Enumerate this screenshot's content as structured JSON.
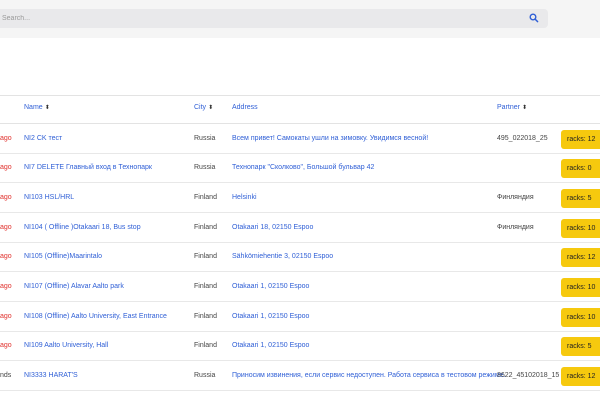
{
  "search": {
    "placeholder": "Search..."
  },
  "table": {
    "headers": {
      "name": "Name",
      "city": "City",
      "address": "Address",
      "partner": "Partner"
    },
    "rows": [
      {
        "time": "ago",
        "name": "NI2 CK тест",
        "city": "Russia",
        "address": "Всем привет! Самокаты ушли на зимовку. Увидимся весной!",
        "partner": "495_022018_25",
        "racks": "racks: 12"
      },
      {
        "time": "ago",
        "name": "NI7 DELETE Главный вход в Технопарк",
        "city": "Russia",
        "address": "Технопарк \"Сколково\", Большой бульвар 42",
        "partner": "",
        "racks": "racks: 0"
      },
      {
        "time": "ago",
        "name": "NI103 HSL/HRL",
        "city": "Finland",
        "address": "Helsinki",
        "partner": "Финляндия",
        "racks": "racks: 5"
      },
      {
        "time": "ago",
        "name": "NI104 ( Offline )Otakaari 18, Bus stop",
        "city": "Finland",
        "address": "Otakaari 18, 02150 Espoo",
        "partner": "Финляндия",
        "racks": "racks: 10"
      },
      {
        "time": "ago",
        "name": "NI105 (Offline)Maarintalo",
        "city": "Finland",
        "address": "Sähkömiehentie 3, 02150 Espoo",
        "partner": "",
        "racks": "racks: 12"
      },
      {
        "time": "ago",
        "name": "NI107 (Offline) Alavar Aalto park",
        "city": "Finland",
        "address": "Otakaari 1, 02150 Espoo",
        "partner": "",
        "racks": "racks: 10"
      },
      {
        "time": "ago",
        "name": "NI108 (Offline) Aalto University, East Entrance",
        "city": "Finland",
        "address": "Otakaari 1, 02150 Espoo",
        "partner": "",
        "racks": "racks: 10"
      },
      {
        "time": "ago",
        "name": "NI109 Aalto University, Hall",
        "city": "Finland",
        "address": "Otakaari 1, 02150 Espoo",
        "partner": "",
        "racks": "racks: 5"
      },
      {
        "time": "nds",
        "name": "NI3333 HARAT'S",
        "city": "Russia",
        "address": "Приносим извинения, если сервис недоступен. Работа сервиса в тестовом режиме.",
        "partner": "8622_45102018_15",
        "racks": "racks: 12"
      }
    ]
  },
  "colors": {
    "link": "#2f5fd6",
    "time_red": "#e0302c",
    "racks_badge": "#f6c90e",
    "topbar_bg": "#f5f5f5"
  },
  "icons": {
    "search": "search-icon",
    "sort": "sort-icon"
  }
}
